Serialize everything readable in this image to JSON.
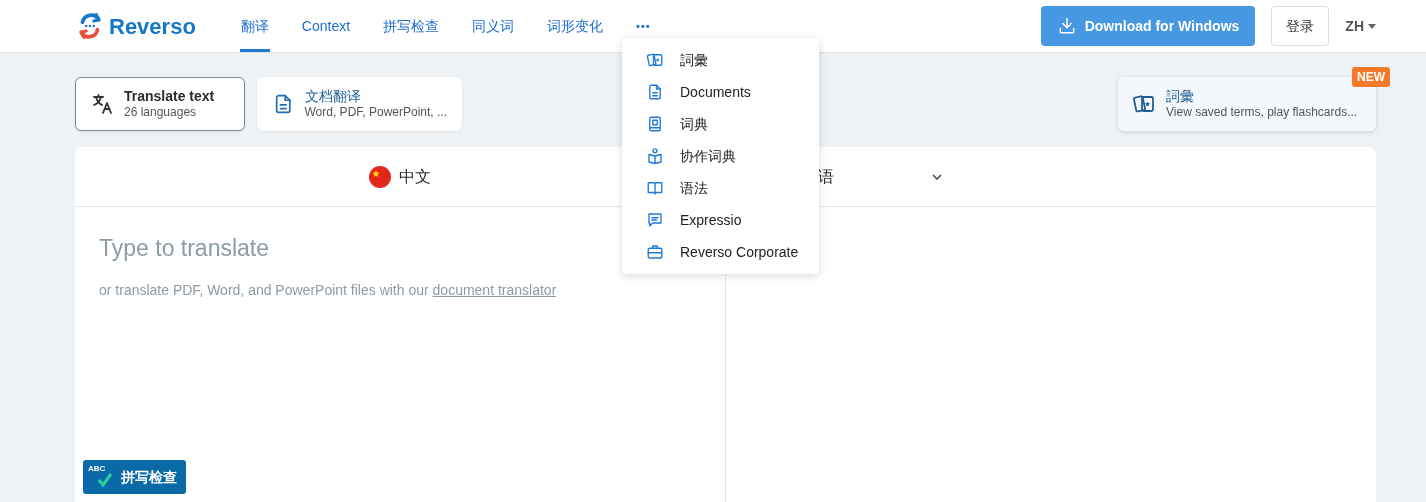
{
  "header": {
    "logo": "Reverso",
    "nav": [
      {
        "label": "翻译",
        "selected": true
      },
      {
        "label": "Context",
        "selected": false
      },
      {
        "label": "拼写检查",
        "selected": false
      },
      {
        "label": "同义词",
        "selected": false
      },
      {
        "label": "词形变化",
        "selected": false
      }
    ],
    "more": "•••",
    "download_button": "Download for Windows",
    "login_button": "登录",
    "language_menu": "ZH"
  },
  "more_menu": [
    {
      "kind": "cards",
      "label": "詞彙"
    },
    {
      "kind": "document",
      "label": "Documents"
    },
    {
      "kind": "dictionary",
      "label": "词典"
    },
    {
      "kind": "collab",
      "label": "协作词典"
    },
    {
      "kind": "book",
      "label": "语法"
    },
    {
      "kind": "chat",
      "label": "Expressio"
    },
    {
      "kind": "briefcase",
      "label": "Reverso Corporate"
    }
  ],
  "modes": [
    {
      "kind": "text",
      "title": "Translate text",
      "subtitle": "26 languages",
      "selected": true
    },
    {
      "kind": "document",
      "title": "文档翻译",
      "subtitle": "Word, PDF, PowerPoint, ...",
      "selected": false
    }
  ],
  "promo": {
    "title": "詞彙",
    "subtitle": "View saved terms, play flashcards...",
    "badge": "NEW"
  },
  "translator": {
    "source_language": "中文",
    "target_language": "语",
    "placeholder": "Type to translate",
    "hint": "or translate PDF, Word, and PowerPoint files with our",
    "hint_link": "document translator",
    "spellcheck": {
      "icon_text": "ABC",
      "label": "拼写检查"
    }
  }
}
